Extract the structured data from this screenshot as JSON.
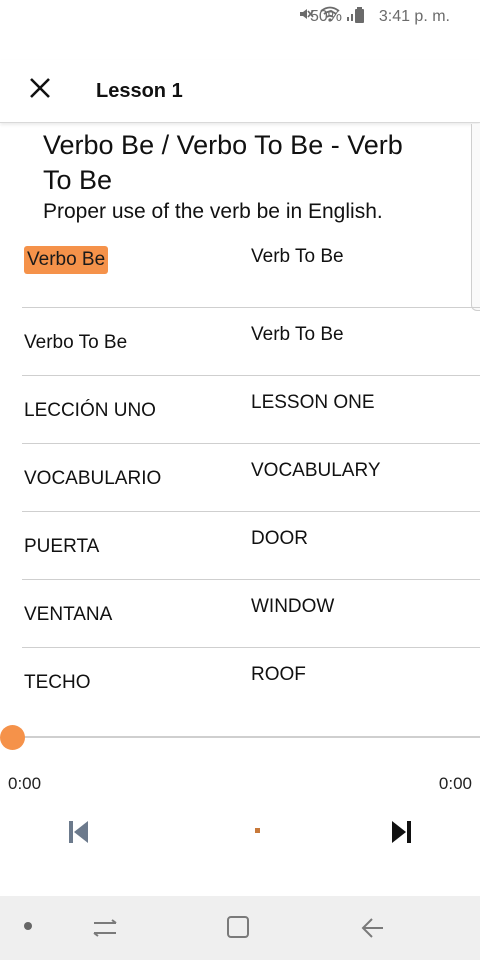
{
  "status_bar": {
    "battery": "50%",
    "time": "3:41 p. m.",
    "icons": [
      "mute-icon",
      "wifi-icon",
      "signal-icon",
      "battery-icon"
    ]
  },
  "header": {
    "close_icon": "close-icon",
    "title": "Lesson 1"
  },
  "topic": {
    "title": "Verbo Be / Verbo To Be - Verb To Be",
    "description": "Proper use of the verb be in English."
  },
  "rows": [
    {
      "spanish": "Verbo Be",
      "english": "Verb To Be",
      "highlighted": true
    },
    {
      "spanish": "Verbo To Be",
      "english": "Verb To Be"
    },
    {
      "spanish": "LECCIÓN UNO",
      "english": "LESSON ONE"
    },
    {
      "spanish": "VOCABULARIO",
      "english": "VOCABULARY"
    },
    {
      "spanish": "PUERTA",
      "english": "DOOR"
    },
    {
      "spanish": "VENTANA",
      "english": "WINDOW"
    },
    {
      "spanish": "TECHO",
      "english": "ROOF"
    }
  ],
  "player": {
    "elapsed": "0:00",
    "duration": "0:00",
    "progress": 0,
    "accent_color": "#f5924a",
    "controls": [
      "skip-previous-icon",
      "play-indicator",
      "skip-next-icon"
    ]
  },
  "nav_bar": {
    "icons": [
      "dot-icon",
      "recent-apps-icon",
      "home-icon",
      "back-icon"
    ]
  }
}
